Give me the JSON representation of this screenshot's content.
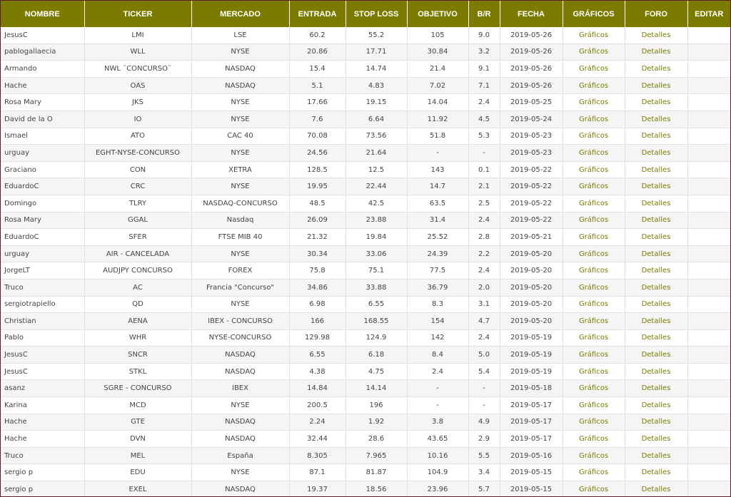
{
  "colors": {
    "header_bg": "#7b7b00",
    "header_text": "#ffffff",
    "link": "#7b7b00",
    "frame_border": "#5c1f2e"
  },
  "headers": [
    "NOMBRE",
    "TICKER",
    "MERCADO",
    "ENTRADA",
    "STOP LOSS",
    "OBJETIVO",
    "B/R",
    "FECHA",
    "GRÁFICOS",
    "FORO",
    "EDITAR"
  ],
  "link_labels": {
    "graficos": "Gráficos",
    "foro": "Detalles"
  },
  "rows": [
    {
      "nombre": "JesusC",
      "ticker": "LMI",
      "mercado": "LSE",
      "entrada": "60.2",
      "stop": "55.2",
      "objetivo": "105",
      "br": "9.0",
      "fecha": "2019-05-26"
    },
    {
      "nombre": "pablogallaecia",
      "ticker": "WLL",
      "mercado": "NYSE",
      "entrada": "20.86",
      "stop": "17.71",
      "objetivo": "30.84",
      "br": "3.2",
      "fecha": "2019-05-26"
    },
    {
      "nombre": "Armando",
      "ticker": "NWL ¨CONCURSO¨",
      "mercado": "NASDAQ",
      "entrada": "15.4",
      "stop": "14.74",
      "objetivo": "21.4",
      "br": "9.1",
      "fecha": "2019-05-26"
    },
    {
      "nombre": "Hache",
      "ticker": "OAS",
      "mercado": "NASDAQ",
      "entrada": "5.1",
      "stop": "4.83",
      "objetivo": "7.02",
      "br": "7.1",
      "fecha": "2019-05-26"
    },
    {
      "nombre": "Rosa Mary",
      "ticker": "JKS",
      "mercado": "NYSE",
      "entrada": "17.66",
      "stop": "19.15",
      "objetivo": "14.04",
      "br": "2.4",
      "fecha": "2019-05-25"
    },
    {
      "nombre": "David de la O",
      "ticker": "IO",
      "mercado": "NYSE",
      "entrada": "7.6",
      "stop": "6.64",
      "objetivo": "11.92",
      "br": "4.5",
      "fecha": "2019-05-24"
    },
    {
      "nombre": "Ismael",
      "ticker": "ATO",
      "mercado": "CAC 40",
      "entrada": "70.08",
      "stop": "73.56",
      "objetivo": "51.8",
      "br": "5.3",
      "fecha": "2019-05-23"
    },
    {
      "nombre": "urguay",
      "ticker": "EGHT-NYSE-CONCURSO",
      "mercado": "NYSE",
      "entrada": "24.56",
      "stop": "21.64",
      "objetivo": "-",
      "br": "-",
      "fecha": "2019-05-23"
    },
    {
      "nombre": "Graciano",
      "ticker": "CON",
      "mercado": "XETRA",
      "entrada": "128.5",
      "stop": "12.5",
      "objetivo": "143",
      "br": "0.1",
      "fecha": "2019-05-22"
    },
    {
      "nombre": "EduardoC",
      "ticker": "CRC",
      "mercado": "NYSE",
      "entrada": "19.95",
      "stop": "22.44",
      "objetivo": "14.7",
      "br": "2.1",
      "fecha": "2019-05-22"
    },
    {
      "nombre": "Domingo",
      "ticker": "TLRY",
      "mercado": "NASDAQ-CONCURSO",
      "entrada": "48.5",
      "stop": "42.5",
      "objetivo": "63.5",
      "br": "2.5",
      "fecha": "2019-05-22"
    },
    {
      "nombre": "Rosa Mary",
      "ticker": "GGAL",
      "mercado": "Nasdaq",
      "entrada": "26.09",
      "stop": "23.88",
      "objetivo": "31.4",
      "br": "2.4",
      "fecha": "2019-05-22"
    },
    {
      "nombre": "EduardoC",
      "ticker": "SFER",
      "mercado": "FTSE MIB 40",
      "entrada": "21.32",
      "stop": "19.84",
      "objetivo": "25.52",
      "br": "2.8",
      "fecha": "2019-05-21"
    },
    {
      "nombre": "urguay",
      "ticker": "AIR - CANCELADA",
      "mercado": "NYSE",
      "entrada": "30.34",
      "stop": "33.06",
      "objetivo": "24.39",
      "br": "2.2",
      "fecha": "2019-05-20"
    },
    {
      "nombre": "JorgeLT",
      "ticker": "AUDJPY CONCURSO",
      "mercado": "FOREX",
      "entrada": "75.8",
      "stop": "75.1",
      "objetivo": "77.5",
      "br": "2.4",
      "fecha": "2019-05-20"
    },
    {
      "nombre": "Truco",
      "ticker": "AC",
      "mercado": "Francia \"Concurso\"",
      "entrada": "34.86",
      "stop": "33.88",
      "objetivo": "36.79",
      "br": "2.0",
      "fecha": "2019-05-20"
    },
    {
      "nombre": "sergiotrapiello",
      "ticker": "QD",
      "mercado": "NYSE",
      "entrada": "6.98",
      "stop": "6.55",
      "objetivo": "8.3",
      "br": "3.1",
      "fecha": "2019-05-20"
    },
    {
      "nombre": "Christian",
      "ticker": "AENA",
      "mercado": "IBEX - CONCURSO",
      "entrada": "166",
      "stop": "168.55",
      "objetivo": "154",
      "br": "4.7",
      "fecha": "2019-05-20"
    },
    {
      "nombre": "Pablo",
      "ticker": "WHR",
      "mercado": "NYSE-CONCURSO",
      "entrada": "129.98",
      "stop": "124.9",
      "objetivo": "142",
      "br": "2.4",
      "fecha": "2019-05-19"
    },
    {
      "nombre": "JesusC",
      "ticker": "SNCR",
      "mercado": "NASDAQ",
      "entrada": "6.55",
      "stop": "6.18",
      "objetivo": "8.4",
      "br": "5.0",
      "fecha": "2019-05-19"
    },
    {
      "nombre": "JesusC",
      "ticker": "STKL",
      "mercado": "NASDAQ",
      "entrada": "4.38",
      "stop": "4.75",
      "objetivo": "2.4",
      "br": "5.4",
      "fecha": "2019-05-19"
    },
    {
      "nombre": "asanz",
      "ticker": "SGRE - CONCURSO",
      "mercado": "IBEX",
      "entrada": "14.84",
      "stop": "14.14",
      "objetivo": "-",
      "br": "-",
      "fecha": "2019-05-18"
    },
    {
      "nombre": "Karina",
      "ticker": "MCD",
      "mercado": "NYSE",
      "entrada": "200.5",
      "stop": "196",
      "objetivo": "-",
      "br": "-",
      "fecha": "2019-05-17"
    },
    {
      "nombre": "Hache",
      "ticker": "GTE",
      "mercado": "NASDAQ",
      "entrada": "2.24",
      "stop": "1.92",
      "objetivo": "3.8",
      "br": "4.9",
      "fecha": "2019-05-17"
    },
    {
      "nombre": "Hache",
      "ticker": "DVN",
      "mercado": "NASDAQ",
      "entrada": "32.44",
      "stop": "28.6",
      "objetivo": "43.65",
      "br": "2.9",
      "fecha": "2019-05-17"
    },
    {
      "nombre": "Truco",
      "ticker": "MEL",
      "mercado": "España",
      "entrada": "8.305",
      "stop": "7.965",
      "objetivo": "10.16",
      "br": "5.5",
      "fecha": "2019-05-16"
    },
    {
      "nombre": "sergio p",
      "ticker": "EDU",
      "mercado": "NYSE",
      "entrada": "87.1",
      "stop": "81.87",
      "objetivo": "104.9",
      "br": "3.4",
      "fecha": "2019-05-15"
    },
    {
      "nombre": "sergio p",
      "ticker": "EXEL",
      "mercado": "NASDAQ",
      "entrada": "19.37",
      "stop": "18.56",
      "objetivo": "23.96",
      "br": "5.7",
      "fecha": "2019-05-15"
    }
  ]
}
